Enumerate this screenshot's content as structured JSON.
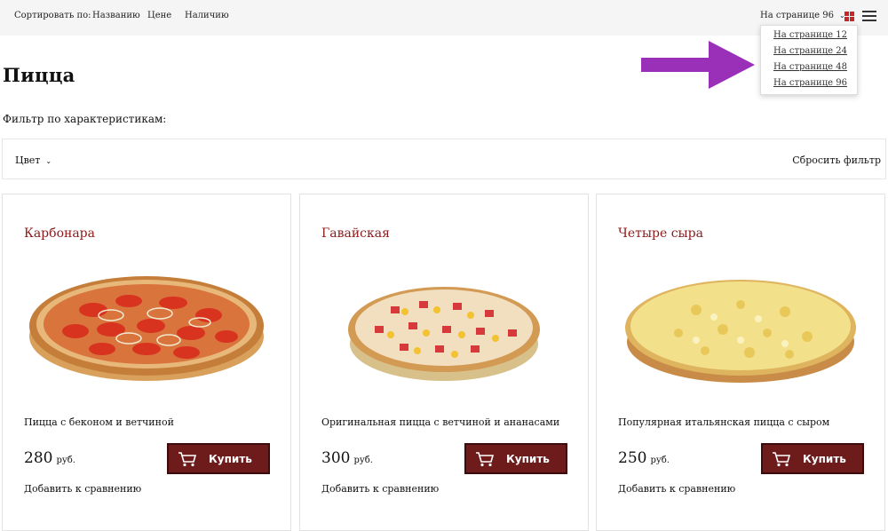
{
  "sort": {
    "label": "Сортировать по:",
    "options": [
      "Названию",
      "Цене",
      "Наличию"
    ]
  },
  "per_page": {
    "current": "На странице 96",
    "options": [
      "На странице 12",
      "На странице 24",
      "На странице 48",
      "На странице 96"
    ]
  },
  "view_icons": [
    "grid-view-icon",
    "list-view-icon"
  ],
  "page_title": "Пицца",
  "filter": {
    "label": "Фильтр по характеристикам:",
    "color_label": "Цвет",
    "reset_label": "Сбросить фильтр"
  },
  "products": [
    {
      "name": "Карбонара",
      "description": "Пицца с беконом и ветчиной",
      "price": "280",
      "currency": "руб.",
      "buy_label": "Купить",
      "compare_label": "Добавить к сравнению"
    },
    {
      "name": "Гавайская",
      "description": "Оригинальная пицца с ветчиной и ананасами",
      "price": "300",
      "currency": "руб.",
      "buy_label": "Купить",
      "compare_label": "Добавить к сравнению"
    },
    {
      "name": "Четыре сыра",
      "description": "Популярная итальянская пицца с сыром",
      "price": "250",
      "currency": "руб.",
      "buy_label": "Купить",
      "compare_label": "Добавить к сравнению"
    }
  ],
  "colors": {
    "accent_red": "#c62828",
    "product_name": "#8b1a1a",
    "buy_button": "#6e1b1b",
    "annotation_arrow": "#9b30b8"
  }
}
